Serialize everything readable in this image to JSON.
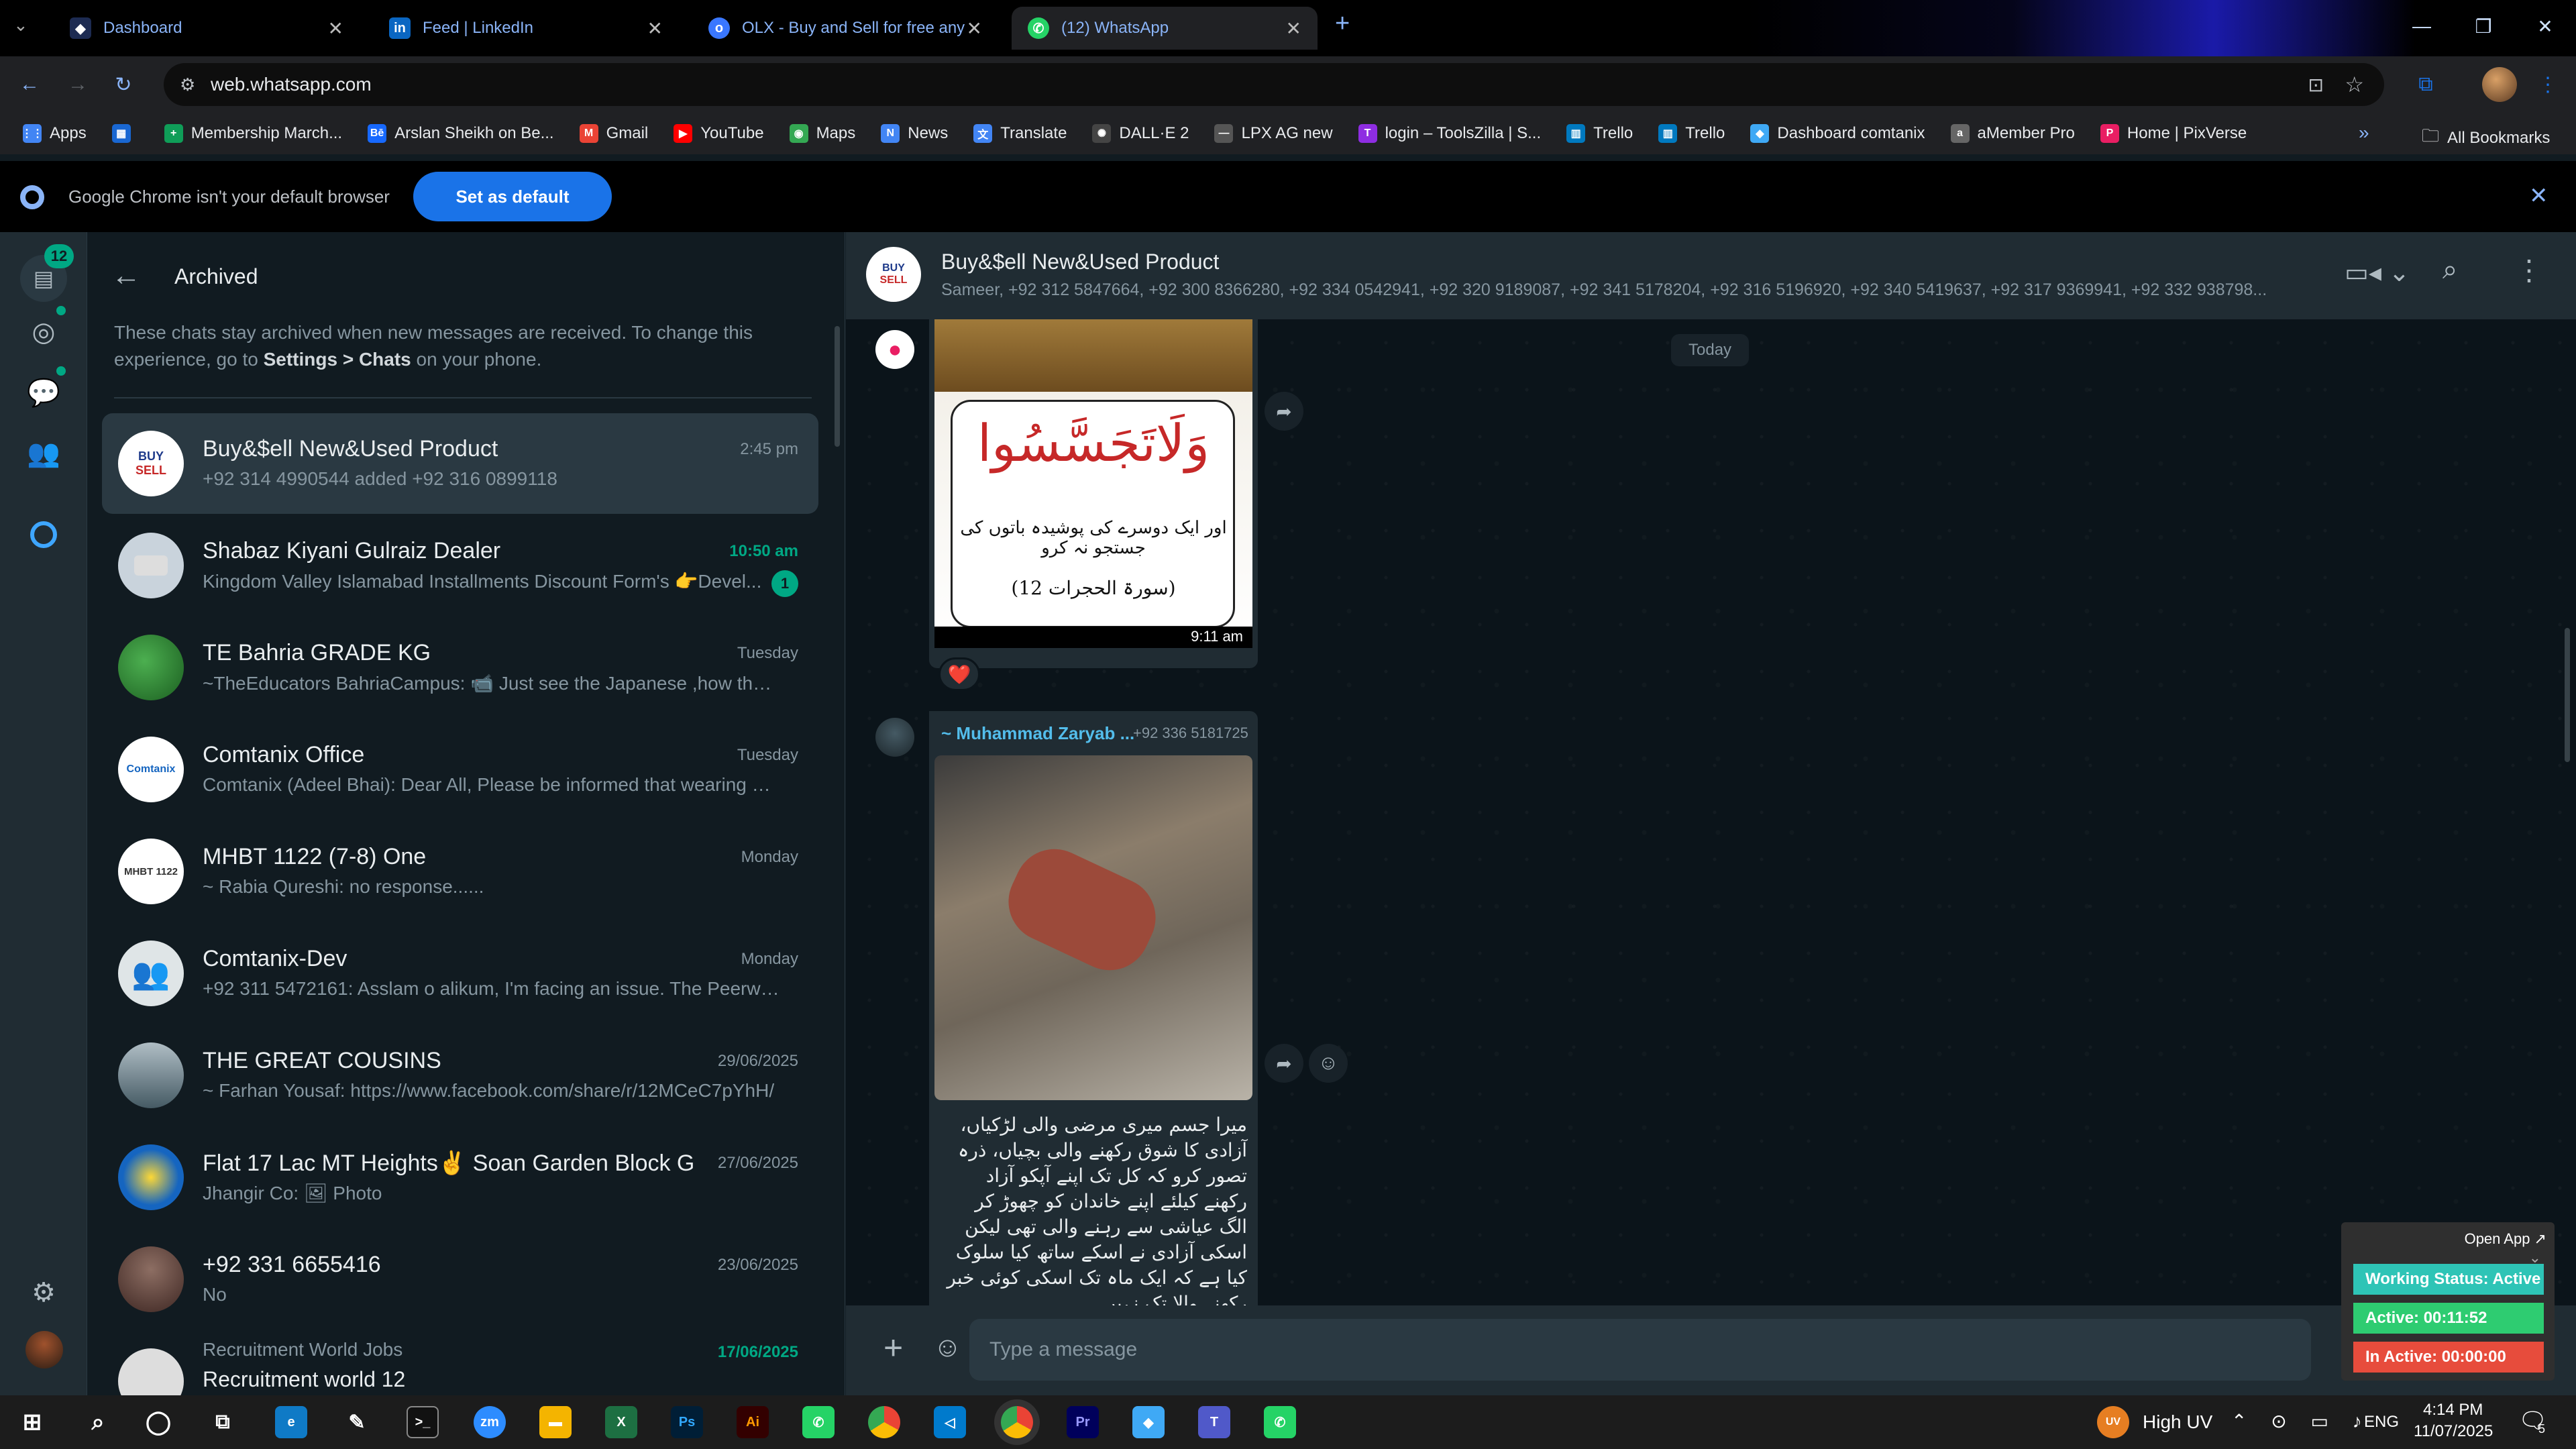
{
  "tabs": [
    {
      "title": "Dashboard",
      "icon": "dashboard-tab-icon",
      "color": "#1d2b52"
    },
    {
      "title": "Feed | LinkedIn",
      "icon": "linkedin-icon",
      "color": "#0a66c2"
    },
    {
      "title": "OLX - Buy and Sell for free any",
      "icon": "olx-icon",
      "color": "#3a77ff"
    },
    {
      "title": "(12) WhatsApp",
      "icon": "whatsapp-icon",
      "color": "#25d366"
    }
  ],
  "url": "web.whatsapp.com",
  "bookmarks": [
    {
      "label": "Apps",
      "color": "#4285f4"
    },
    {
      "label": "",
      "color": "#4285f4"
    },
    {
      "label": "Membership March...",
      "color": "#0f9d58"
    },
    {
      "label": "Arslan Sheikh on Be...",
      "color": "#1769ff"
    },
    {
      "label": "Gmail",
      "color": "#ea4335"
    },
    {
      "label": "YouTube",
      "color": "#ff0000"
    },
    {
      "label": "Maps",
      "color": "#34a853"
    },
    {
      "label": "News",
      "color": "#4285f4"
    },
    {
      "label": "Translate",
      "color": "#4285f4"
    },
    {
      "label": "DALL·E 2",
      "color": "#444444"
    },
    {
      "label": "LPX AG new",
      "color": "#555555"
    },
    {
      "label": "login – ToolsZilla | S...",
      "color": "#8e2de2"
    },
    {
      "label": "Trello",
      "color": "#0079bf"
    },
    {
      "label": "Trello",
      "color": "#0079bf"
    },
    {
      "label": "Dashboard comtanix",
      "color": "#3fa9f5"
    },
    {
      "label": "aMember Pro",
      "color": "#666666"
    },
    {
      "label": "Home | PixVerse",
      "color": "#e91e63"
    }
  ],
  "all_bookmarks": "All Bookmarks",
  "infobar": {
    "text": "Google Chrome isn't your default browser",
    "button": "Set as default"
  },
  "rail": {
    "badge": "12"
  },
  "archived": {
    "title": "Archived",
    "note_pre": "These chats stay archived when new messages are received. To change this experience, go to ",
    "note_bold": "Settings > Chats",
    "note_post": " on your phone."
  },
  "chats": [
    {
      "name": "Buy&$ell New&Used Product",
      "msg": "+92 314 4990544 added +92 316 0899118",
      "time": "2:45 pm",
      "unread": "",
      "avatar_color": "#ffffff",
      "avatar_text": "BUY SELL"
    },
    {
      "name": "Shabaz Kiyani Gulraiz Dealer",
      "msg": "Kingdom Valley Islamabad Installments Discount Form's 👉Devel...",
      "time": "10:50 am",
      "unread": "1",
      "avatar_color": "#c9d3dc",
      "avatar_text": ""
    },
    {
      "name": "TE Bahria GRADE KG",
      "msg": "~TheEducators BahriaCampus: 📹 Just see  the Japanese ,how they ...",
      "time": "Tuesday",
      "unread": "",
      "avatar_color": "#2e7d32",
      "avatar_text": ""
    },
    {
      "name": "Comtanix Office",
      "msg": "Comtanix (Adeel Bhai): Dear All,  Please be informed that wearing yo...",
      "time": "Tuesday",
      "unread": "",
      "avatar_color": "#ffffff",
      "avatar_text": "Comtanix"
    },
    {
      "name": "MHBT 1122 (7-8) One",
      "msg": "~ Rabia Qureshi: no response......",
      "time": "Monday",
      "unread": "",
      "avatar_color": "#ffffff",
      "avatar_text": "MHBT 1122"
    },
    {
      "name": "Comtanix-Dev",
      "msg": "+92 311 5472161: Asslam o alikum, I'm facing an issue. The Peerwad...",
      "time": "Monday",
      "unread": "",
      "avatar_color": "#dfe5e7",
      "avatar_text": ""
    },
    {
      "name": "THE GREAT COUSINS",
      "msg": "~ Farhan Yousaf: https://www.facebook.com/share/r/12MCeC7pYhH/",
      "time": "29/06/2025",
      "unread": "",
      "avatar_color": "#8a9ba8",
      "avatar_text": ""
    },
    {
      "name": "Flat 17 Lac MT Heights✌️  Soan Garden Block G",
      "msg": "Jhangir Co: 🖼 Photo",
      "time": "27/06/2025",
      "unread": "",
      "avatar_color": "#1565c0",
      "avatar_text": ""
    },
    {
      "name": "+92 331 6655416",
      "msg": "No",
      "time": "23/06/2025",
      "unread": "",
      "avatar_color": "#6d6d6d",
      "avatar_text": ""
    },
    {
      "name": "Recruitment World Jobs",
      "msg": "Recruitment world 12",
      "time": "17/06/2025",
      "unread": "",
      "avatar_color": "#dddddd",
      "avatar_text": ""
    }
  ],
  "conversation": {
    "name": "Buy&$ell New&Used Product",
    "members": "Sameer, +92 312 5847664, +92 300 8366280, +92 334 0542941, +92 320 9189087, +92 341 5178204, +92 316 5196920, +92 340 5419637, +92 317 9369941, +92 332 938798...",
    "date": "Today",
    "img1_title": "وَلَاتَجَسَّسُوا",
    "img1_sub": "اور ایک دوسرے کی پوشیدہ باتوں کی جستجو نہ کرو",
    "img1_ref": "(سورۃ الحجرات 12)",
    "msg1_time": "9:11 am",
    "reaction": "❤️",
    "sender": "~ Muhammad Zaryab ...",
    "sender_phone": "+92 336 5181725",
    "urdu_text": "میرا جسم میری مرضی والی لڑکیاں، آزادی کا شوق رکھنے والی بچیاں، ذرہ تصور کرو کہ کل تک اپنے آپکو آزاد رکھنے کیلئے اپنے خاندان کو چھوڑ کر الگ عیاشی سے رہنے والی تھی لیکن اسکی آزادی نے اسکے ساتھ کیا سلوک کیا ہے کہ ایک ماہ تک اسکی کوئی خبر رکھنے والا تک نہیں",
    "placeholder": "Type a message"
  },
  "tracker": {
    "open": "Open App ↗",
    "status": "Working Status: Active",
    "active": "Active: 00:11:52",
    "inactive": "In Active: 00:00:00",
    "status_color": "#2ec4b6",
    "active_color": "#2ecc71",
    "inactive_color": "#e74c3c"
  },
  "taskbar": {
    "weather": "High UV",
    "lang": "ENG",
    "time": "4:14 PM",
    "date": "11/07/2025",
    "notif": "5"
  }
}
